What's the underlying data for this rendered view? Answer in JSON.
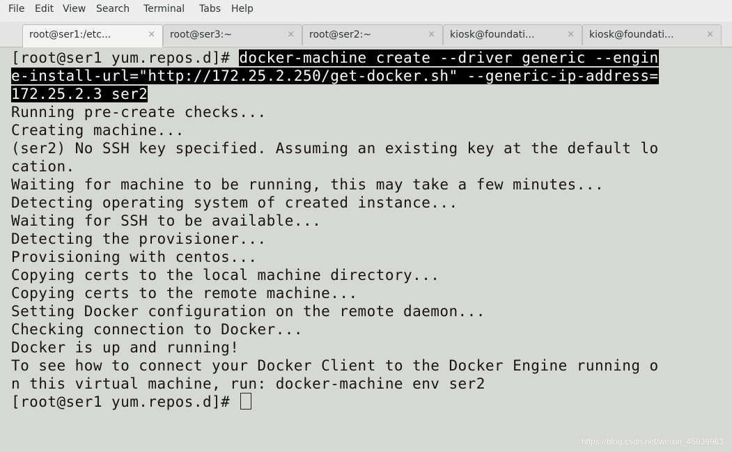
{
  "menubar": {
    "items": [
      "File",
      "Edit",
      "View",
      "Search",
      "Terminal",
      "Tabs",
      "Help"
    ]
  },
  "tabs": [
    {
      "label": "root@ser1:/etc...",
      "close": "×",
      "active": true
    },
    {
      "label": "root@ser3:~",
      "close": "×",
      "active": false
    },
    {
      "label": "root@ser2:~",
      "close": "×",
      "active": false
    },
    {
      "label": "kiosk@foundati...",
      "close": "×",
      "active": false
    },
    {
      "label": "kiosk@foundati...",
      "close": "×",
      "active": false
    }
  ],
  "terminal": {
    "prompt": "[root@ser1 yum.repos.d]# ",
    "command_lines": [
      "docker-machine create --driver generic --engin",
      "e-install-url=\"http://172.25.2.250/get-docker.sh\" --generic-ip-address=",
      "172.25.2.3 ser2"
    ],
    "output": [
      "Running pre-create checks...",
      "Creating machine...",
      "(ser2) No SSH key specified. Assuming an existing key at the default lo",
      "cation.",
      "Waiting for machine to be running, this may take a few minutes...",
      "Detecting operating system of created instance...",
      "Waiting for SSH to be available...",
      "Detecting the provisioner...",
      "Provisioning with centos...",
      "Copying certs to the local machine directory...",
      "Copying certs to the remote machine...",
      "Setting Docker configuration on the remote daemon...",
      "Checking connection to Docker...",
      "Docker is up and running!",
      "To see how to connect your Docker Client to the Docker Engine running o",
      "n this virtual machine, run: docker-machine env ser2"
    ],
    "final_prompt": "[root@ser1 yum.repos.d]# "
  },
  "watermark": "https://blog.csdn.net/weixin_45039963"
}
